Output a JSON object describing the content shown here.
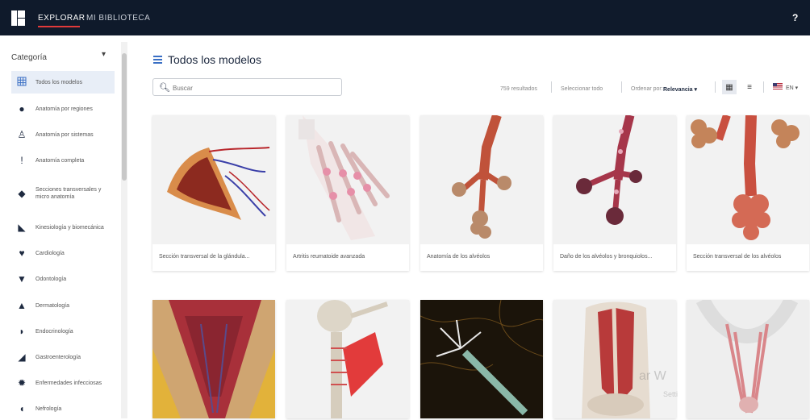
{
  "topbar": {
    "explore": "EXPLORAR",
    "library": "MI BIBLIOTECA",
    "help": "?"
  },
  "sidebar": {
    "header": "Categoría",
    "items": [
      {
        "label": "Todos los modelos",
        "icon": "grid-icon"
      },
      {
        "label": "Anatomía por regiones",
        "icon": "head-icon"
      },
      {
        "label": "Anatomía por sistemas",
        "icon": "body-icon"
      },
      {
        "label": "Anatomía completa",
        "icon": "skeleton-icon"
      },
      {
        "label": "Secciones transversales y micro anatomía",
        "icon": "section-icon"
      },
      {
        "label": "Kinesiología y biomecánica",
        "icon": "running-icon"
      },
      {
        "label": "Cardiología",
        "icon": "heart-icon"
      },
      {
        "label": "Odontología",
        "icon": "tooth-icon"
      },
      {
        "label": "Dermatología",
        "icon": "skin-icon"
      },
      {
        "label": "Endocrinología",
        "icon": "thyroid-icon"
      },
      {
        "label": "Gastroenterología",
        "icon": "stomach-icon"
      },
      {
        "label": "Enfermedades infecciosas",
        "icon": "virus-icon"
      },
      {
        "label": "Nefrología",
        "icon": "kidney-icon"
      }
    ]
  },
  "main": {
    "title": "Todos los modelos",
    "search_placeholder": "Buscar",
    "results": "759 resultados",
    "select_all": "Seleccionar todo",
    "sort_label": "Ordenar por:",
    "sort_value": "Relevancia ▾",
    "lang": "EN ▾"
  },
  "cards": [
    {
      "label": "Sección transversal de la glándula..."
    },
    {
      "label": "Artritis reumatoide avanzada"
    },
    {
      "label": "Anatomía de los alvéolos"
    },
    {
      "label": "Daño de los alvéolos y bronquiolos..."
    },
    {
      "label": "Sección transversal de los alvéolos"
    },
    {
      "label": ""
    },
    {
      "label": ""
    },
    {
      "label": ""
    },
    {
      "label": ""
    },
    {
      "label": ""
    }
  ],
  "watermark": {
    "line1": "ar W",
    "line2": "Setti"
  },
  "colors": {
    "topbar": "#0f1a2b",
    "accent": "#e03a3a",
    "active_bg": "#e8eef7"
  }
}
